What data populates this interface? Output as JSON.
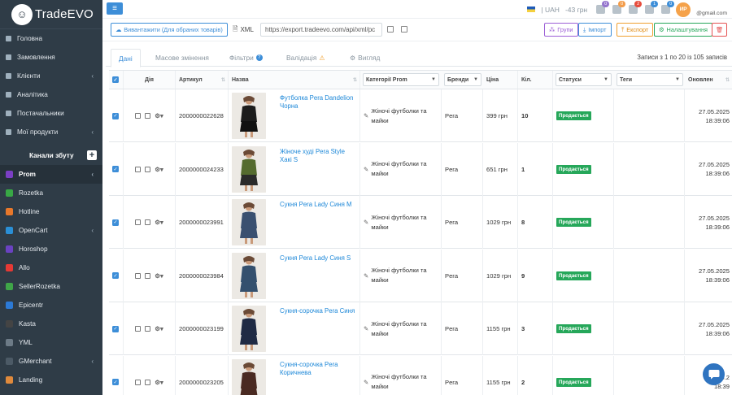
{
  "brand": "TradeEVO",
  "sidebar": {
    "items": [
      {
        "label": "Головна",
        "chevron": false
      },
      {
        "label": "Замовлення",
        "chevron": false
      },
      {
        "label": "Клієнти",
        "chevron": true
      },
      {
        "label": "Аналітика",
        "chevron": false
      },
      {
        "label": "Постачальники",
        "chevron": false
      },
      {
        "label": "Мої продукти",
        "chevron": true
      }
    ],
    "channels_title": "Канали збуту",
    "channels": [
      {
        "label": "Prom",
        "color": "#7b3fc4",
        "active": true,
        "chevron": true
      },
      {
        "label": "Rozetka",
        "color": "#38a845",
        "active": false,
        "chevron": false
      },
      {
        "label": "Hotline",
        "color": "#e8782b",
        "active": false,
        "chevron": false
      },
      {
        "label": "OpenCart",
        "color": "#2a8fd6",
        "active": false,
        "chevron": true
      },
      {
        "label": "Horoshop",
        "color": "#6a42c2",
        "active": false,
        "chevron": false
      },
      {
        "label": "Allo",
        "color": "#e53935",
        "active": false,
        "chevron": false
      },
      {
        "label": "SellerRozetka",
        "color": "#3fa548",
        "active": false,
        "chevron": false
      },
      {
        "label": "Epicentr",
        "color": "#2c7ad6",
        "active": false,
        "chevron": false
      },
      {
        "label": "Kasta",
        "color": "#444444",
        "active": false,
        "chevron": false
      },
      {
        "label": "YML",
        "color": "#6d7b87",
        "active": false,
        "chevron": false
      },
      {
        "label": "GMerchant",
        "color": "#4c5a66",
        "active": false,
        "chevron": true
      },
      {
        "label": "Landing",
        "color": "#e08a3c",
        "active": false,
        "chevron": false
      }
    ]
  },
  "topbar": {
    "currency": "| UAH",
    "balance": "-43 грн",
    "badges": [
      {
        "count": "0",
        "color": "#9575cd"
      },
      {
        "count": "0",
        "color": "#f39c49"
      },
      {
        "count": "2",
        "color": "#e74c3c"
      },
      {
        "count": "1",
        "color": "#3d8ed8"
      },
      {
        "count": "0",
        "color": "#3d8ed8"
      }
    ],
    "avatar_initials": "ИР",
    "user_email": "@gmail.com"
  },
  "toolbar": {
    "export_selected": "Вивантажити (Для обраних товарів)",
    "xml_label": "XML",
    "xml_url": "https://export.tradeevo.com/api/xml/pc",
    "groups": "Групи",
    "import": "Імпорт",
    "export": "Експорт",
    "settings": "Налаштування"
  },
  "tabs": [
    {
      "label": "Дані",
      "active": true
    },
    {
      "label": "Масове змінення",
      "active": false
    },
    {
      "label": "Фільтри",
      "active": false
    },
    {
      "label": "Валідація",
      "active": false
    },
    {
      "label": "Вигляд",
      "active": false
    }
  ],
  "records_info": "Записи з 1 по 20 із 105 записів",
  "table": {
    "headers": {
      "action": "Дія",
      "sku": "Артикул",
      "name": "Назва",
      "category": "Категорії Prom",
      "brand": "Бренди",
      "price": "Ціна",
      "qty": "Кіл.",
      "status": "Статуси",
      "tags": "Теги",
      "updated": "Оновлен"
    },
    "rows": [
      {
        "sku": "2000000022628",
        "name": "Футболка Pera Dandelion Чорна",
        "category": "Жіночі футболки та майки",
        "brand": "Pera",
        "price": "399 грн",
        "qty": "10",
        "status": "Продається",
        "date": "27.05.2025",
        "time": "18:39:06",
        "garment": "#1c1c1c",
        "garment2": "#111"
      },
      {
        "sku": "2000000024233",
        "name": "Жіноче худі Pera Style Хакі S",
        "category": "Жіночі футболки та майки",
        "brand": "Pera",
        "price": "651 грн",
        "qty": "1",
        "status": "Продається",
        "date": "27.05.2025",
        "time": "18:39:06",
        "garment": "#556b2f",
        "garment2": "#2a2a2a"
      },
      {
        "sku": "2000000023991",
        "name": "Сукня Pera Lady Синя M",
        "category": "Жіночі футболки та майки",
        "brand": "Pera",
        "price": "1029 грн",
        "qty": "8",
        "status": "Продається",
        "date": "27.05.2025",
        "time": "18:39:06",
        "garment": "#3a5070",
        "garment2": "#3a5070"
      },
      {
        "sku": "2000000023984",
        "name": "Сукня Pera Lady Синя S",
        "category": "Жіночі футболки та майки",
        "brand": "Pera",
        "price": "1029 грн",
        "qty": "9",
        "status": "Продається",
        "date": "27.05.2025",
        "time": "18:39:06",
        "garment": "#34506e",
        "garment2": "#34506e"
      },
      {
        "sku": "2000000023199",
        "name": "Сукня-сорочка Pera Синя",
        "category": "Жіночі футболки та майки",
        "brand": "Pera",
        "price": "1155 грн",
        "qty": "3",
        "status": "Продається",
        "date": "27.05.2025",
        "time": "18:39:06",
        "garment": "#1f2a44",
        "garment2": "#1f2a44"
      },
      {
        "sku": "2000000023205",
        "name": "Сукня-сорочка Pera Коричнева",
        "category": "Жіночі футболки та майки",
        "brand": "Pera",
        "price": "1155 грн",
        "qty": "2",
        "status": "Продається",
        "date": "27.05.2",
        "time": "18:39",
        "garment": "#4a2a22",
        "garment2": "#4a2a22"
      }
    ]
  }
}
